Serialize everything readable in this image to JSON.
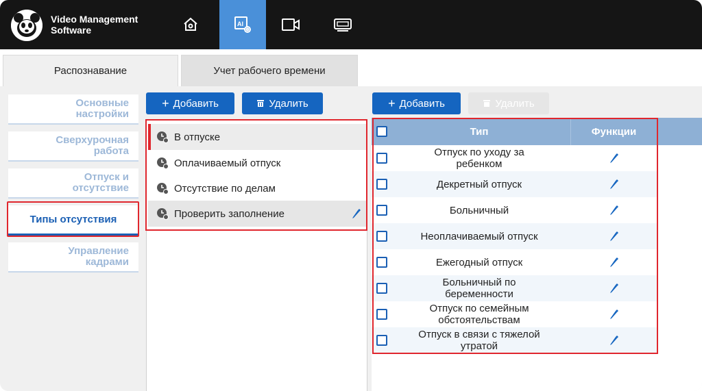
{
  "app": {
    "title_line1": "Video Management",
    "title_line2": "Software"
  },
  "nav": [
    {
      "name": "home-icon",
      "active": false
    },
    {
      "name": "ai-settings-icon",
      "active": true
    },
    {
      "name": "camera-icon",
      "active": false
    },
    {
      "name": "nvr-device-icon",
      "active": false
    }
  ],
  "tabs": [
    {
      "label": "Распознавание"
    },
    {
      "label": "Учет рабочего времени"
    }
  ],
  "sidebar": {
    "items": [
      {
        "line1": "Основные",
        "line2": "настройки"
      },
      {
        "line1": "Сверхурочная",
        "line2": "работа"
      },
      {
        "line1": "Отпуск и",
        "line2": "отсутствие"
      },
      {
        "line1": "Типы отсутствия",
        "line2": ""
      },
      {
        "line1": "Управление",
        "line2": "кадрами"
      }
    ]
  },
  "mid": {
    "add_label": "Добавить",
    "delete_label": "Удалить",
    "items": [
      {
        "label": "В отпуске"
      },
      {
        "label": "Оплачиваемый отпуск"
      },
      {
        "label": "Отсутствие по делам"
      },
      {
        "label": "Проверить заполнение"
      }
    ]
  },
  "right": {
    "add_label": "Добавить",
    "delete_label": "Удалить",
    "columns": {
      "type": "Тип",
      "functions": "Функции"
    },
    "rows": [
      {
        "line1": "Отпуск по уходу за",
        "line2": "ребенком"
      },
      {
        "line1": "Декретный отпуск",
        "line2": ""
      },
      {
        "line1": "Больничный",
        "line2": ""
      },
      {
        "line1": "Неоплачиваемый отпуск",
        "line2": ""
      },
      {
        "line1": "Ежегодный отпуск",
        "line2": ""
      },
      {
        "line1": "Больничный по",
        "line2": "беременности"
      },
      {
        "line1": "Отпуск по семейным",
        "line2": "обстоятельствам"
      },
      {
        "line1": "Отпуск в связи с тяжелой",
        "line2": "утратой"
      }
    ]
  },
  "colors": {
    "accent": "#1565c0",
    "highlight": "#e0262d",
    "topbar": "#151515",
    "table_header": "#8eb0d5"
  }
}
